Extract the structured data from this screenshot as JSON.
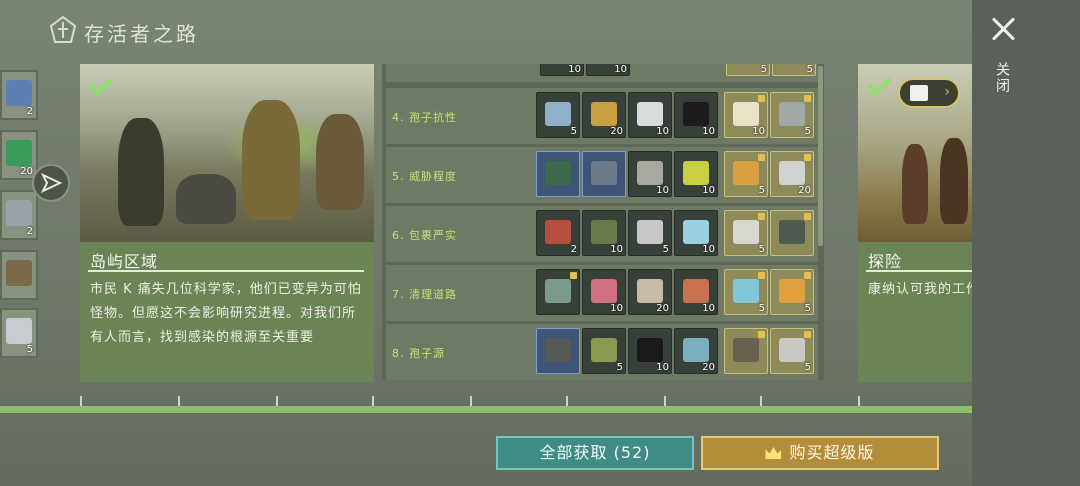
{
  "header": {
    "title": "存活者之路"
  },
  "close": {
    "label": "关闭"
  },
  "left_strip": {
    "slots": [
      {
        "count": "2",
        "color": "#5d7fb4"
      },
      {
        "count": "20",
        "color": "#3a9a5a"
      },
      {
        "count": "2",
        "color": "#9aa2a8"
      },
      {
        "count": "",
        "color": "#7a6a4a"
      },
      {
        "count": "5",
        "color": "#c8ccd0"
      }
    ]
  },
  "card": {
    "title": "岛屿区域",
    "body": "市民 K 痛失几位科学家，他们已变异为可怕怪物。但愿这不会影响研究进程。对我们所有人而言，找到感染的根源至关重要"
  },
  "rewards": {
    "top_partial_counts": [
      "10",
      "10",
      "5",
      "5"
    ],
    "rows": [
      {
        "label": "4. 孢子抗性",
        "items": [
          {
            "count": "5",
            "tier": "dark",
            "icon": "metal-ingot-icon",
            "color": "#8fb0c8"
          },
          {
            "count": "20",
            "tier": "dark",
            "icon": "herb-icon",
            "color": "#c9a040"
          },
          {
            "count": "10",
            "tier": "dark",
            "icon": "engine-part-icon",
            "color": "#d8dcdc"
          },
          {
            "count": "10",
            "tier": "dark",
            "icon": "cloth-icon",
            "color": "#1c1c1c"
          },
          {
            "count": "10",
            "tier": "gold",
            "icon": "paper-icon",
            "color": "#e8e2c8",
            "locked": true
          },
          {
            "count": "5",
            "tier": "gold",
            "icon": "lens-icon",
            "color": "#a0a8a8",
            "locked": true
          }
        ]
      },
      {
        "label": "5. 威胁程度",
        "items": [
          {
            "count": "",
            "tier": "blue",
            "icon": "armor-vest-icon",
            "color": "#3c6a4a"
          },
          {
            "count": "",
            "tier": "blue",
            "icon": "rifle-icon",
            "color": "#6a7a8a"
          },
          {
            "count": "10",
            "tier": "dark",
            "icon": "fabric-roll-icon",
            "color": "#a8a8a0"
          },
          {
            "count": "10",
            "tier": "dark",
            "icon": "chemical-jar-icon",
            "color": "#c8d040"
          },
          {
            "count": "5",
            "tier": "gold",
            "icon": "filter-icon",
            "color": "#d8a040",
            "locked": true
          },
          {
            "count": "20",
            "tier": "gold",
            "icon": "crystal-icon",
            "color": "#d0d4d0",
            "locked": true
          }
        ]
      },
      {
        "label": "6. 包裹严实",
        "items": [
          {
            "count": "2",
            "tier": "dark",
            "icon": "shovel-icon",
            "color": "#b85040"
          },
          {
            "count": "10",
            "tier": "dark",
            "icon": "medkit-bag-icon",
            "color": "#6a7a4a"
          },
          {
            "count": "5",
            "tier": "dark",
            "icon": "spring-icon",
            "color": "#c8c8c8"
          },
          {
            "count": "10",
            "tier": "dark",
            "icon": "glass-plate-icon",
            "color": "#9ad0e0"
          },
          {
            "count": "5",
            "tier": "gold",
            "icon": "steel-bar-icon",
            "color": "#d8d8d0",
            "locked": true
          },
          {
            "count": "",
            "tier": "gold",
            "icon": "assault-rifle-icon",
            "color": "#505a50",
            "locked": true
          }
        ]
      },
      {
        "label": "7. 清理道路",
        "items": [
          {
            "count": "",
            "tier": "dark",
            "icon": "grenade-launcher-icon",
            "color": "#7a9a8a",
            "locked": true
          },
          {
            "count": "10",
            "tier": "dark",
            "icon": "brain-icon",
            "color": "#d07080"
          },
          {
            "count": "20",
            "tier": "dark",
            "icon": "ore-icon",
            "color": "#c8b8a8"
          },
          {
            "count": "10",
            "tier": "dark",
            "icon": "copper-ingot-icon",
            "color": "#c87050"
          },
          {
            "count": "5",
            "tier": "gold",
            "icon": "inhaler-icon",
            "color": "#80c8d8",
            "locked": true
          },
          {
            "count": "5",
            "tier": "gold",
            "icon": "fuel-bottle-icon",
            "color": "#e0a040",
            "locked": true
          }
        ]
      },
      {
        "label": "8. 孢子源",
        "items": [
          {
            "count": "",
            "tier": "blue",
            "icon": "atv-vehicle-icon",
            "color": "#555a58"
          },
          {
            "count": "5",
            "tier": "dark",
            "icon": "jerry-can-icon",
            "color": "#8a9a50"
          },
          {
            "count": "10",
            "tier": "dark",
            "icon": "cloth-icon",
            "color": "#1a1a1a"
          },
          {
            "count": "20",
            "tier": "dark",
            "icon": "wire-coil-icon",
            "color": "#7ab0c0"
          },
          {
            "count": "",
            "tier": "gold",
            "icon": "sniper-rifle-icon",
            "color": "#6a6050",
            "locked": true
          },
          {
            "count": "5",
            "tier": "gold",
            "icon": "metal-beam-icon",
            "color": "#c8c8c4",
            "locked": true
          }
        ]
      }
    ]
  },
  "card2": {
    "title": "探险",
    "body": "康纳认可我的工作，相信这片土地会繁荣发展下去"
  },
  "buttons": {
    "claim_all": "全部获取 (52)",
    "buy_premium": "购买超级版"
  }
}
